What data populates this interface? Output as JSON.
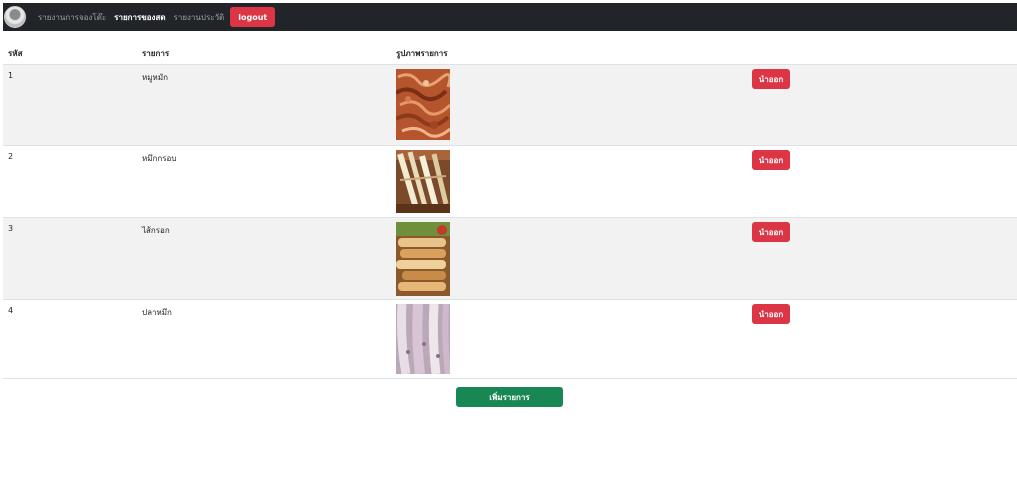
{
  "nav": {
    "links": [
      "รายงานการจองโต๊ะ",
      "รายการของสด",
      "รายงานประวัติ"
    ],
    "logout_label": "logout"
  },
  "table": {
    "headers": [
      "รหัส",
      "รายการ",
      "รูปภาพรายการ"
    ],
    "rows": [
      {
        "id": "1",
        "name": "หมูหมัก",
        "image": "marinated-pork-photo"
      },
      {
        "id": "2",
        "name": "หมึกกรอบ",
        "image": "crispy-squid-photo"
      },
      {
        "id": "3",
        "name": "ไส้กรอก",
        "image": "sausage-photo"
      },
      {
        "id": "4",
        "name": "ปลาหมึก",
        "image": "squid-photo"
      }
    ],
    "remove_label": "นำออก"
  },
  "add_label": "เพิ่มรายการ",
  "colors": {
    "navbar": "#212529",
    "danger": "#dc3545",
    "success": "#198754",
    "stripe": "#f2f2f2"
  }
}
